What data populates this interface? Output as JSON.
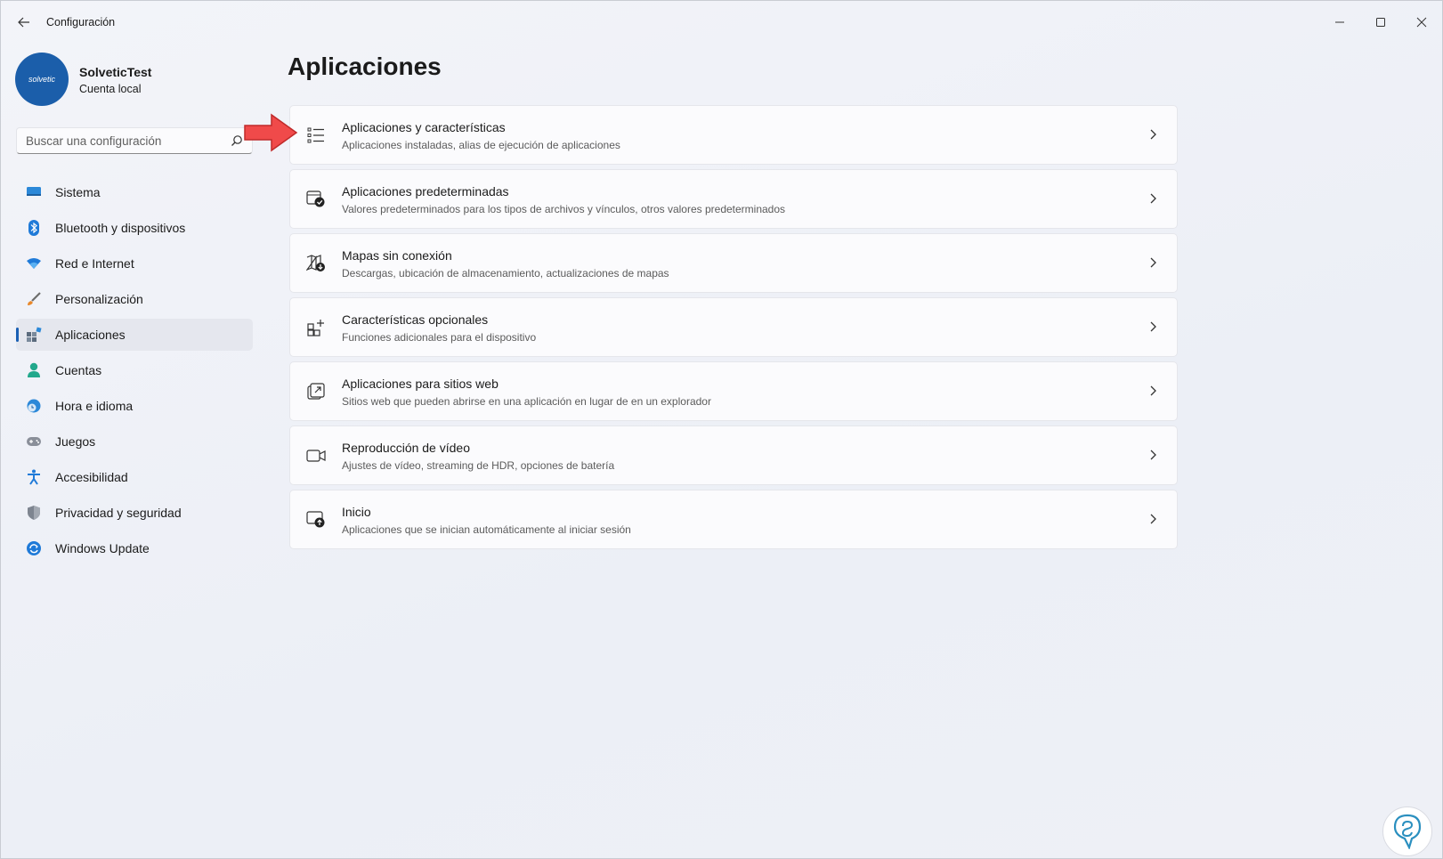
{
  "window": {
    "title": "Configuración"
  },
  "profile": {
    "name": "SolveticTest",
    "account_type": "Cuenta local",
    "avatar_text": "solvetic"
  },
  "search": {
    "placeholder": "Buscar una configuración",
    "value": ""
  },
  "sidebar": {
    "items": [
      {
        "label": "Sistema",
        "icon": "monitor-icon",
        "active": false
      },
      {
        "label": "Bluetooth y dispositivos",
        "icon": "bluetooth-icon",
        "active": false
      },
      {
        "label": "Red e Internet",
        "icon": "wifi-icon",
        "active": false
      },
      {
        "label": "Personalización",
        "icon": "paintbrush-icon",
        "active": false
      },
      {
        "label": "Aplicaciones",
        "icon": "apps-icon",
        "active": true
      },
      {
        "label": "Cuentas",
        "icon": "person-icon",
        "active": false
      },
      {
        "label": "Hora e idioma",
        "icon": "clock-globe-icon",
        "active": false
      },
      {
        "label": "Juegos",
        "icon": "gamepad-icon",
        "active": false
      },
      {
        "label": "Accesibilidad",
        "icon": "accessibility-icon",
        "active": false
      },
      {
        "label": "Privacidad y seguridad",
        "icon": "shield-icon",
        "active": false
      },
      {
        "label": "Windows Update",
        "icon": "update-icon",
        "active": false
      }
    ]
  },
  "main": {
    "title": "Aplicaciones",
    "cards": [
      {
        "title": "Aplicaciones y características",
        "subtitle": "Aplicaciones instaladas, alias de ejecución de aplicaciones",
        "icon": "list-icon"
      },
      {
        "title": "Aplicaciones predeterminadas",
        "subtitle": "Valores predeterminados para los tipos de archivos y vínculos, otros valores predeterminados",
        "icon": "default-apps-icon"
      },
      {
        "title": "Mapas sin conexión",
        "subtitle": "Descargas, ubicación de almacenamiento, actualizaciones de mapas",
        "icon": "map-download-icon"
      },
      {
        "title": "Características opcionales",
        "subtitle": "Funciones adicionales para el dispositivo",
        "icon": "add-grid-icon"
      },
      {
        "title": "Aplicaciones para sitios web",
        "subtitle": "Sitios web que pueden abrirse en una aplicación en lugar de en un explorador",
        "icon": "open-web-icon"
      },
      {
        "title": "Reproducción de vídeo",
        "subtitle": "Ajustes de vídeo, streaming de HDR, opciones de batería",
        "icon": "video-camera-icon"
      },
      {
        "title": "Inicio",
        "subtitle": "Aplicaciones que se inician automáticamente al iniciar sesión",
        "icon": "startup-icon"
      }
    ]
  },
  "colors": {
    "accent": "#1a5fb4",
    "annotation_arrow": "#f04a4a",
    "avatar": "#1b5eaa"
  }
}
